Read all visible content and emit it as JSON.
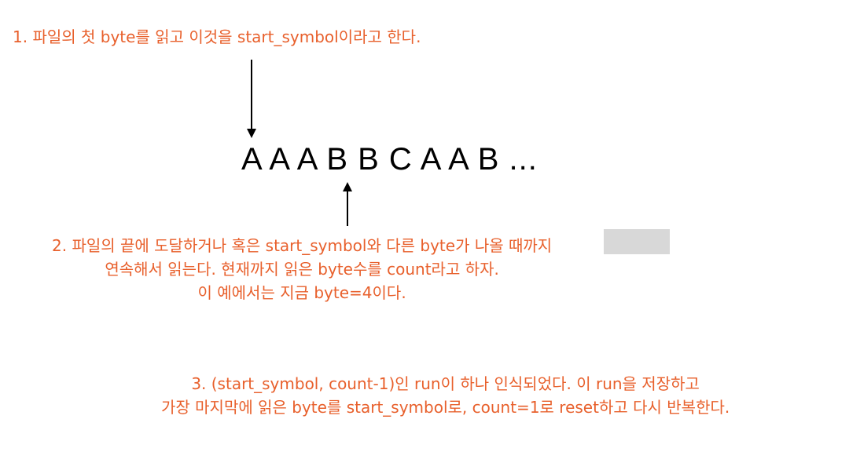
{
  "steps": {
    "step1": "1. 파일의 첫 byte를 읽고 이것을 start_symbol이라고 한다.",
    "step2_lines": [
      "2. 파일의 끝에 도달하거나 혹은 start_symbol와 다른 byte가 나올 때까지",
      "연속해서 읽는다. 현재까지 읽은 byte수를 count라고 하자.",
      "이 예에서는 지금 byte=4이다."
    ],
    "step3_lines": [
      "3. (start_symbol,  count-1)인 run이 하나 인식되었다. 이 run을 저장하고",
      "가장 마지막에 읽은 byte를 start_symbol로, count=1로 reset하고 다시 반복한다."
    ]
  },
  "sequence": "A A A B B C A A B ...",
  "colors": {
    "annotation_text": "#e8602c",
    "sequence_text": "#000000",
    "arrow": "#000000",
    "highlight": "#d8d8d8"
  }
}
